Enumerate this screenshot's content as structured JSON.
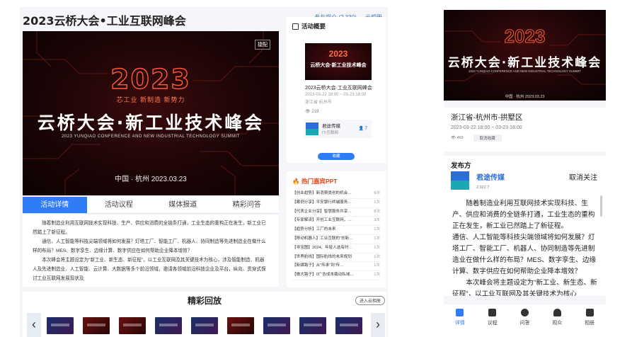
{
  "desktop": {
    "title": "2023云桥大会•工业互联网峰会",
    "header_links": [
      "参与观众 (2,330)",
      "云相册"
    ],
    "banner": {
      "logo": "捷配",
      "year": "2023",
      "tagline": "芯工业 新制造 新势力",
      "name": "云桥大会·新工业技术峰会",
      "english": "2023 YUNQIAO CONFERENCE AND NEW INDUSTRIAL TECHNOLOGY SUMMIT",
      "place": "中国 · 杭州  2023.03.23"
    },
    "tabs": [
      "活动详情",
      "活动议程",
      "媒体报道",
      "精彩问答"
    ],
    "article": [
      "随着制造业利用互联网技术实现科技、生产、供应和消费的全链条打通，工业生态的重构正在发生，新工业已然踏上了新征程。",
      "通信、人工智能等科技尖端领域将如何发展？灯塔工厂、智能工厂、机器人、协同制造等先进制造业在做什么样的布局？MES、数字孪生、边缘计算、数字供应在如何帮助企业降本增效？",
      "本次峰会将主题设定为“新工业、新生态、新征程”，以工业互联网及其关键技术为核心，涉及智能制造、机器人及先进制造业、人工智能、云计算、大数据等多个前沿领域，邀请各领域前沿科技企业及平台，纵向、贯穿式探讨工业互联网发展现状及"
    ],
    "replay": {
      "title": "精彩回放",
      "enter_button": "进入云相册",
      "prev": "‹",
      "next": "›",
      "thumbnails": 9
    },
    "overview": {
      "heading": "活动概要",
      "thumb_year": "2023",
      "thumb_name": "云桥大会·新工业技术峰会",
      "name": "2023云桥大会·工业互联网峰会",
      "time": "2023-03-22 18:00 ~ 03-23 18:00",
      "location": "浙江省 杭州市",
      "views": "219",
      "organizer": "君途传媒",
      "organizer_sub": "IT/互联网",
      "fans": "7",
      "collect_button": "收藏"
    },
    "hot": {
      "heading": "热门嘉宾PPT",
      "items": [
        {
          "text": "【创业趋势】新消费类创的机会…",
          "count": "9次"
        },
        {
          "text": "【案例分享】平安银行终端服务…",
          "count": "1次"
        },
        {
          "text": "【代表企业分享】智慧服务共享…",
          "count": "8次"
        },
        {
          "text": "【专家解读】开创工业互联网，…",
          "count": "3次"
        },
        {
          "text": "【趋势分析】工厂的未来",
          "count": "1次"
        },
        {
          "text": "【移动机器人】工业互联的“创新…",
          "count": "1次"
        },
        {
          "text": "【寻宝图】2024，年轻人选有时…",
          "count": "1次"
        },
        {
          "text": "【世界航线】国际航线的未来规划",
          "count": "1次"
        },
        {
          "text": "【新媒路子】从“传承”到“传…",
          "count": "1次"
        },
        {
          "text": "【做大路子】0广告成本撬动私域…",
          "count": "1次"
        }
      ]
    }
  },
  "mobile": {
    "banner": {
      "year": "2023",
      "name": "云桥大会·新工业技术峰会",
      "english": "2023 YUNQIAO CONFERENCE AND NEW INDUSTRIAL TECHNOLOGY SUMMIT",
      "place": "中国 · 杭州  2023.03.23"
    },
    "location": "浙江省-杭州市-拱墅区",
    "time": "2023-03-22 18:00 ~ 03-23 18:00",
    "views": "469",
    "cancel_collect": "取消收藏",
    "publisher_label": "发布方",
    "publisher_name": "君途传媒",
    "publisher_stats": "2,922  7",
    "unfollow": "取消关注",
    "article": [
      "随着制造业利用互联网技术实现科技、生产、供应和消费的全链条打通，工业生态的重构正在发生，新工业已然踏上了新征程。",
      "通信、人工智能等科技尖端领域将如何发展？灯塔工厂、智能工厂、机器人、协同制造等先进制造业在做什么样的布局？MES、数字孪生、边缘计算、数字供应在如何帮助企业降本增效？",
      "本次峰会将主题设定为“新工业、新生态、新征程”，以工业互联网及其关键技术为核心"
    ],
    "nav": [
      {
        "label": "详情",
        "icon": "detail-icon"
      },
      {
        "label": "议程",
        "icon": "calendar-icon"
      },
      {
        "label": "问答",
        "icon": "question-icon"
      },
      {
        "label": "观众",
        "icon": "people-icon"
      },
      {
        "label": "相册",
        "icon": "album-icon"
      }
    ]
  },
  "colors": {
    "accent": "#2f7cf6",
    "hot": "#e2451c",
    "banner_dark": "#1c0506",
    "banner_glow": "#ff5a3c"
  }
}
